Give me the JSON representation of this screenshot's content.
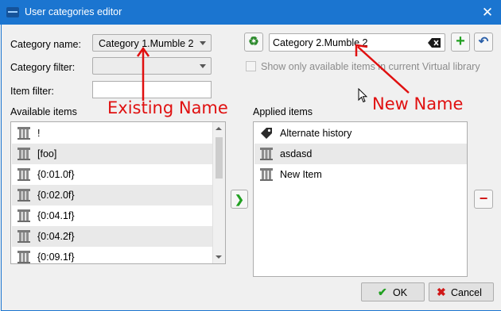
{
  "window": {
    "title": "User categories editor",
    "close_glyph": "✕"
  },
  "form": {
    "category_name_label": "Category name:",
    "category_name_value": "Category 1.Mumble 2",
    "category_filter_label": "Category filter:",
    "category_filter_value": "",
    "item_filter_label": "Item filter:",
    "item_filter_value": "",
    "new_name_value": "Category 2.Mumble 2",
    "show_only_available_label": "Show only available items in current Virtual library"
  },
  "available": {
    "label": "Available items",
    "items": [
      "!",
      "[foo]",
      "{0:01.0f}",
      "{0:02.0f}",
      "{0:04.1f}",
      "{0:04.2f}",
      "{0:09.1f}"
    ]
  },
  "applied": {
    "label": "Applied items",
    "items": [
      "Alternate history",
      "asdasd",
      "New Item"
    ]
  },
  "buttons": {
    "ok": "OK",
    "cancel": "Cancel"
  },
  "annotations": {
    "existing": "Existing Name",
    "new": "New Name"
  },
  "colors": {
    "annotation": "#e01010",
    "titlebar": "#1b75d0"
  },
  "icons": [
    "recycle-icon",
    "clear-text-icon",
    "plus-icon",
    "undo-icon",
    "column-icon",
    "tag-icon",
    "arrow-right-icon",
    "minus-icon",
    "check-icon",
    "x-icon"
  ]
}
